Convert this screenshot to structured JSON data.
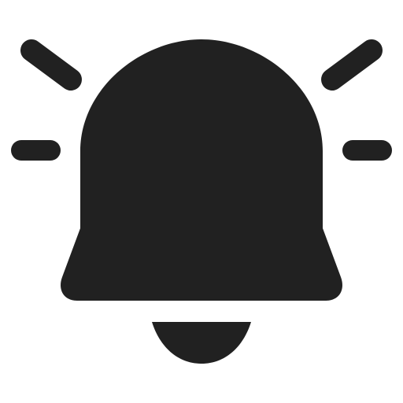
{
  "icon": {
    "name": "bell-alert-icon",
    "color": "#212121",
    "background": "#ffffff"
  }
}
